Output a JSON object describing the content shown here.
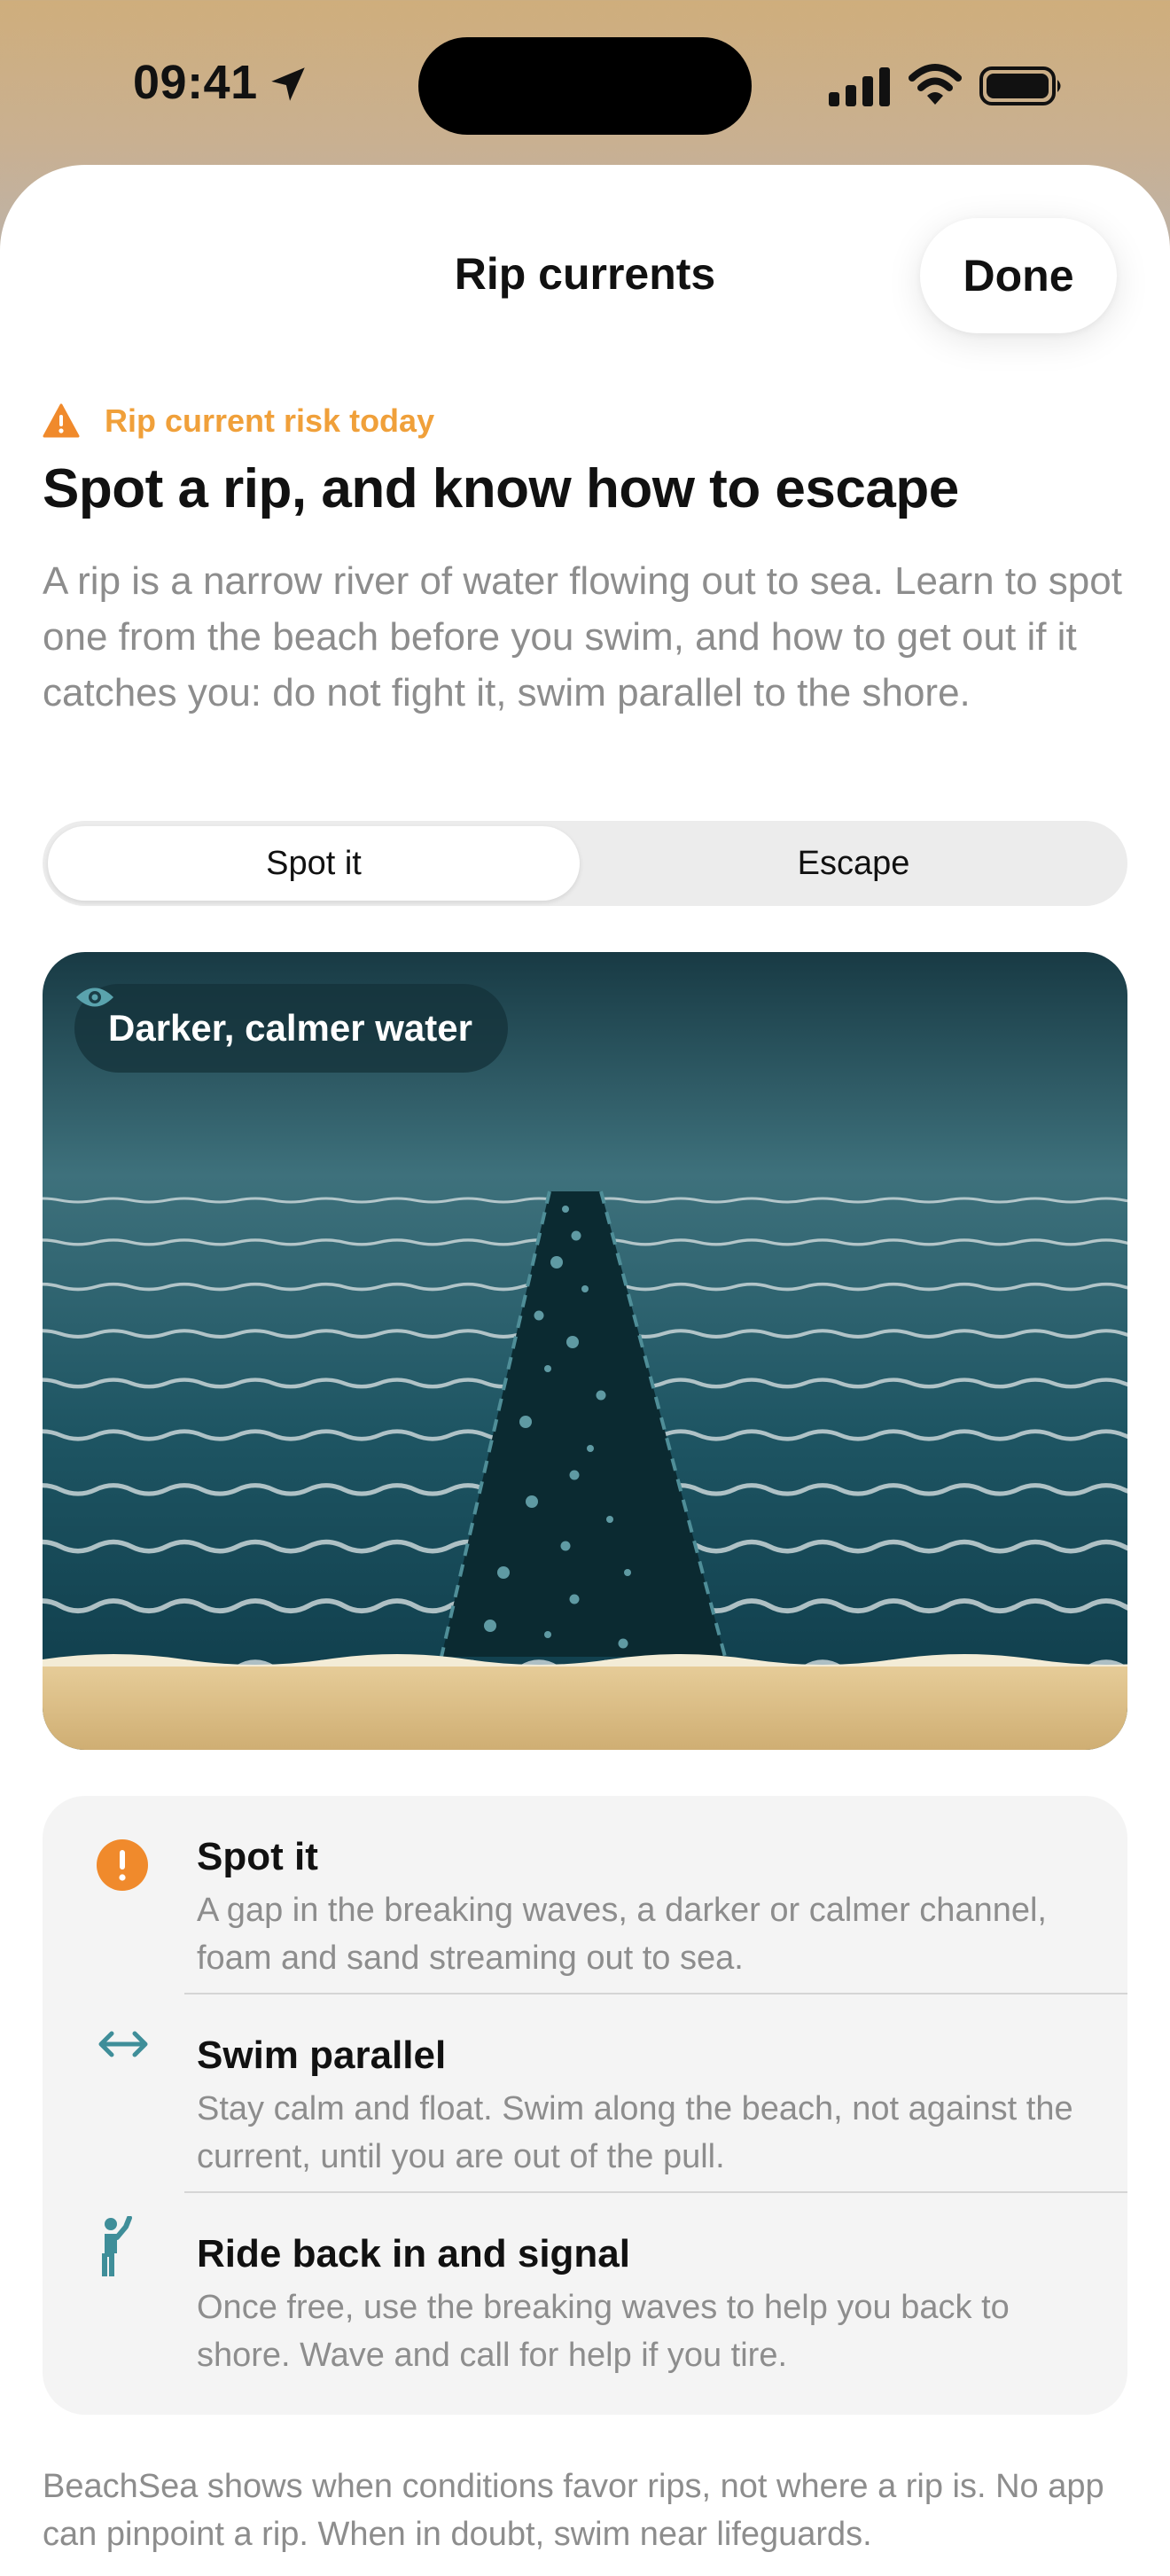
{
  "status_bar": {
    "time": "09:41",
    "icons": [
      "location-arrow-icon",
      "cellular-signal-icon",
      "wifi-icon",
      "battery-icon"
    ]
  },
  "sheet": {
    "title": "Rip currents",
    "done_label": "Done"
  },
  "risk": {
    "icon": "warning-triangle-icon",
    "label": "Rip current risk today",
    "color": "#f0a03a"
  },
  "headline": "Spot a rip, and know how to escape",
  "intro": "A rip is a narrow river of water flowing out to sea. Learn to spot one from the beach before you swim, and how to get out if it catches you: do not fight it, swim parallel to the shore.",
  "segmented": {
    "options": [
      "Spot it",
      "Escape"
    ],
    "selected": "Spot it"
  },
  "illustration": {
    "chip_icon": "eye-icon",
    "chip_label": "Darker, calmer water",
    "colors": {
      "sea_top": "#1e4750",
      "sea_bottom": "#0f3a46",
      "rip": "#0b2a31",
      "sand": "#dbbd85",
      "foam": "#f3ecd6"
    }
  },
  "tips": [
    {
      "icon": "exclamation-circle-icon",
      "title": "Spot it",
      "body": "A gap in the breaking waves, a darker or calmer channel, foam and sand streaming out to sea."
    },
    {
      "icon": "arrow-left-right-icon",
      "title": "Swim parallel",
      "body": "Stay calm and float. Swim along the beach, not against the current, until you are out of the pull."
    },
    {
      "icon": "person-waving-icon",
      "title": "Ride back in and signal",
      "body": "Once free, use the breaking waves to help you back to shore. Wave and call for help if you tire."
    }
  ],
  "footnote": "BeachSea shows when conditions favor rips, not where a rip is. No app can pinpoint a rip. When in doubt, swim near lifeguards.",
  "accent_colors": {
    "orange": "#f08a2c",
    "teal": "#3f8e99"
  }
}
